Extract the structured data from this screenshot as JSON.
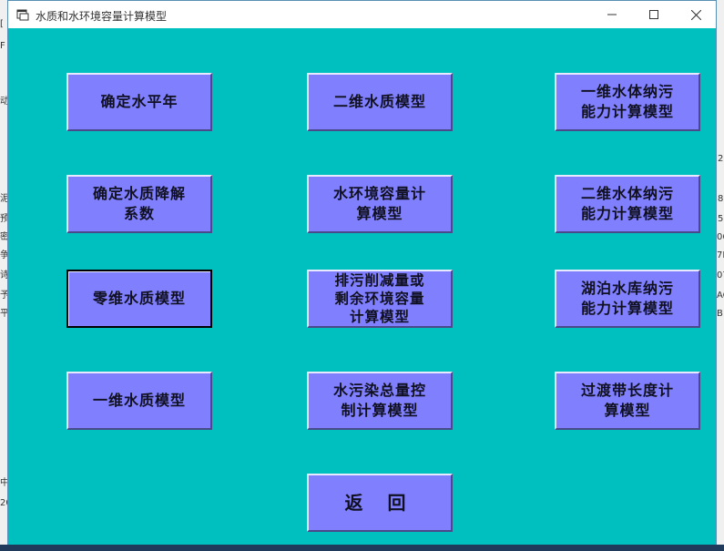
{
  "window": {
    "title": "水质和水环境容量计算模型"
  },
  "buttons": {
    "b1": "确定水平年",
    "b2": "二维水质模型",
    "b3": "一维水体纳污\n能力计算模型",
    "b4": "确定水质降解\n系数",
    "b5": "水环境容量计\n算模型",
    "b6": "二维水体纳污\n能力计算模型",
    "b7": "零维水质模型",
    "b8": "排污削减量或\n剩余环境容量\n计算模型",
    "b9": "湖泊水库纳污\n能力计算模型",
    "b10": "一维水质模型",
    "b11": "水污染总量控\n制计算模型",
    "b12": "过渡带长度计\n算模型",
    "return": "返 回"
  },
  "background": {
    "left_glyphs": [
      "[",
      "F",
      "动",
      "泥",
      "预",
      "密",
      "争",
      "诗",
      "予",
      "平",
      "中",
      "20"
    ],
    "right_glyphs": [
      "2",
      "8",
      "5",
      "06",
      "7D",
      "07",
      "AC",
      "B"
    ]
  }
}
